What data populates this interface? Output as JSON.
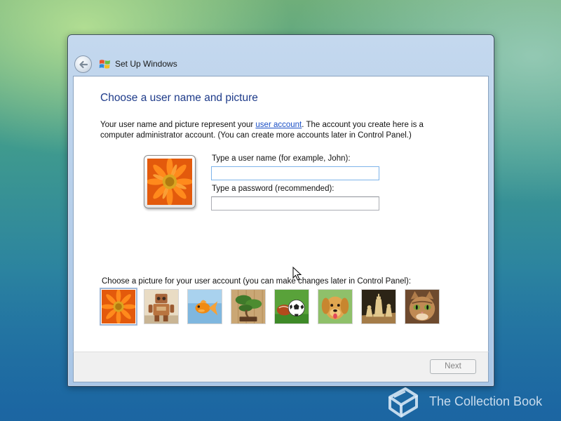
{
  "window": {
    "title": "Set Up Windows"
  },
  "page": {
    "heading": "Choose a user name and picture",
    "intro_before_link": "Your user name and picture represent your ",
    "intro_link": "user account",
    "intro_after_link": ". The account you create here is a computer administrator account. (You can create more accounts later in Control Panel.)"
  },
  "form": {
    "username_label": "Type a user name (for example, John):",
    "username_value": "",
    "password_label": "Type a password (recommended):",
    "password_value": ""
  },
  "pictures": {
    "label": "Choose a picture for your user account (you can make changes later in Control Panel):",
    "items": [
      "flower",
      "robot",
      "fish",
      "bonsai",
      "soccer-ball",
      "dog",
      "chess",
      "kitten"
    ],
    "selected": "flower"
  },
  "footer": {
    "next_label": "Next"
  },
  "watermark": {
    "text": "The Collection Book"
  },
  "colors": {
    "heading": "#1e3b8a",
    "link": "#1a4fc6"
  }
}
